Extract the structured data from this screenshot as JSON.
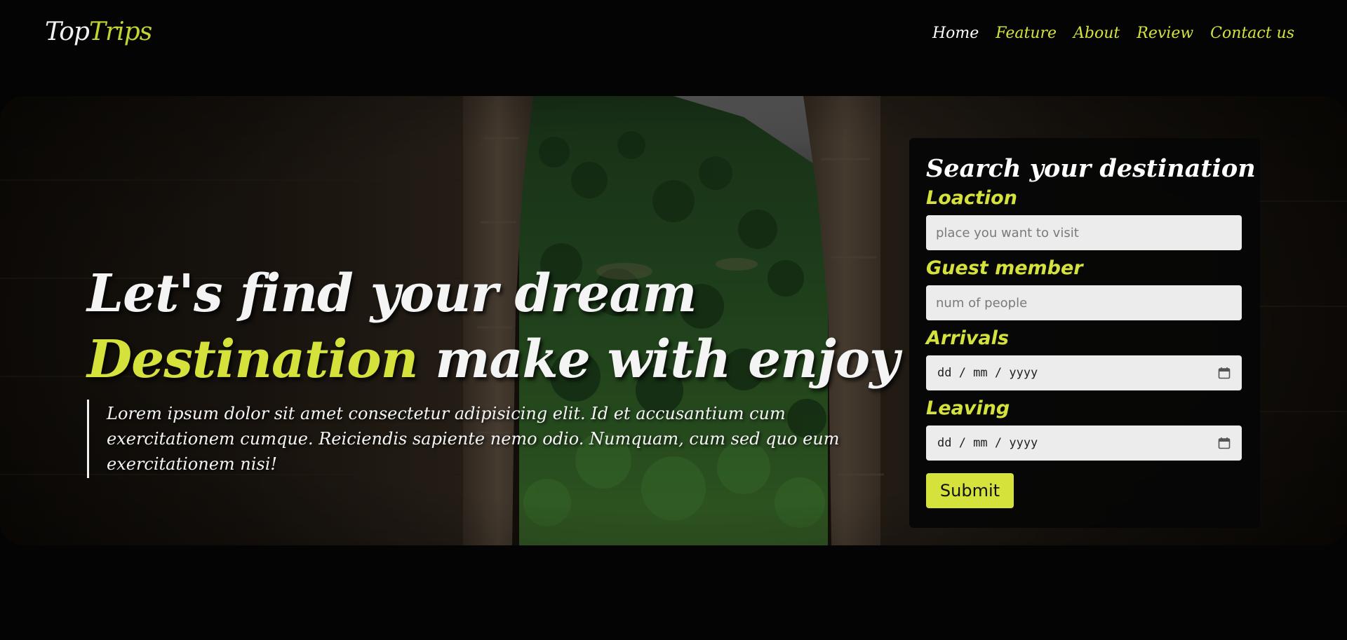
{
  "brand": {
    "logo_part1": "Top",
    "logo_part2": "Trips"
  },
  "nav": {
    "items": [
      {
        "label": "Home",
        "active": true
      },
      {
        "label": "Feature",
        "active": false
      },
      {
        "label": "About",
        "active": false
      },
      {
        "label": "Review",
        "active": false
      },
      {
        "label": "Contact us",
        "active": false
      }
    ]
  },
  "hero": {
    "title_line1": "Let's find your dream",
    "title_accent": "Destination",
    "title_rest": "make with enjoy",
    "description": "Lorem ipsum dolor sit amet consectetur adipisicing elit. Id et accusantium cum exercitationem cumque. Reiciendis sapiente nemo odio. Numquam, cum sed quo eum exercitationem nisi!"
  },
  "search": {
    "title": "Search your destination",
    "location_label": "Loaction",
    "location_placeholder": "place you want to visit",
    "guest_label": "Guest member",
    "guest_placeholder": "num of people",
    "arrivals_label": "Arrivals",
    "arrivals_value": "dd / mm / yyyy",
    "leaving_label": "Leaving",
    "leaving_value": "dd / mm / yyyy",
    "submit_label": "Submit"
  },
  "colors": {
    "accent": "#d4e23b",
    "logo_accent": "#c3d432",
    "background": "#040404",
    "text": "#f4f4f4"
  },
  "icons": {
    "calendar": "calendar-icon"
  }
}
